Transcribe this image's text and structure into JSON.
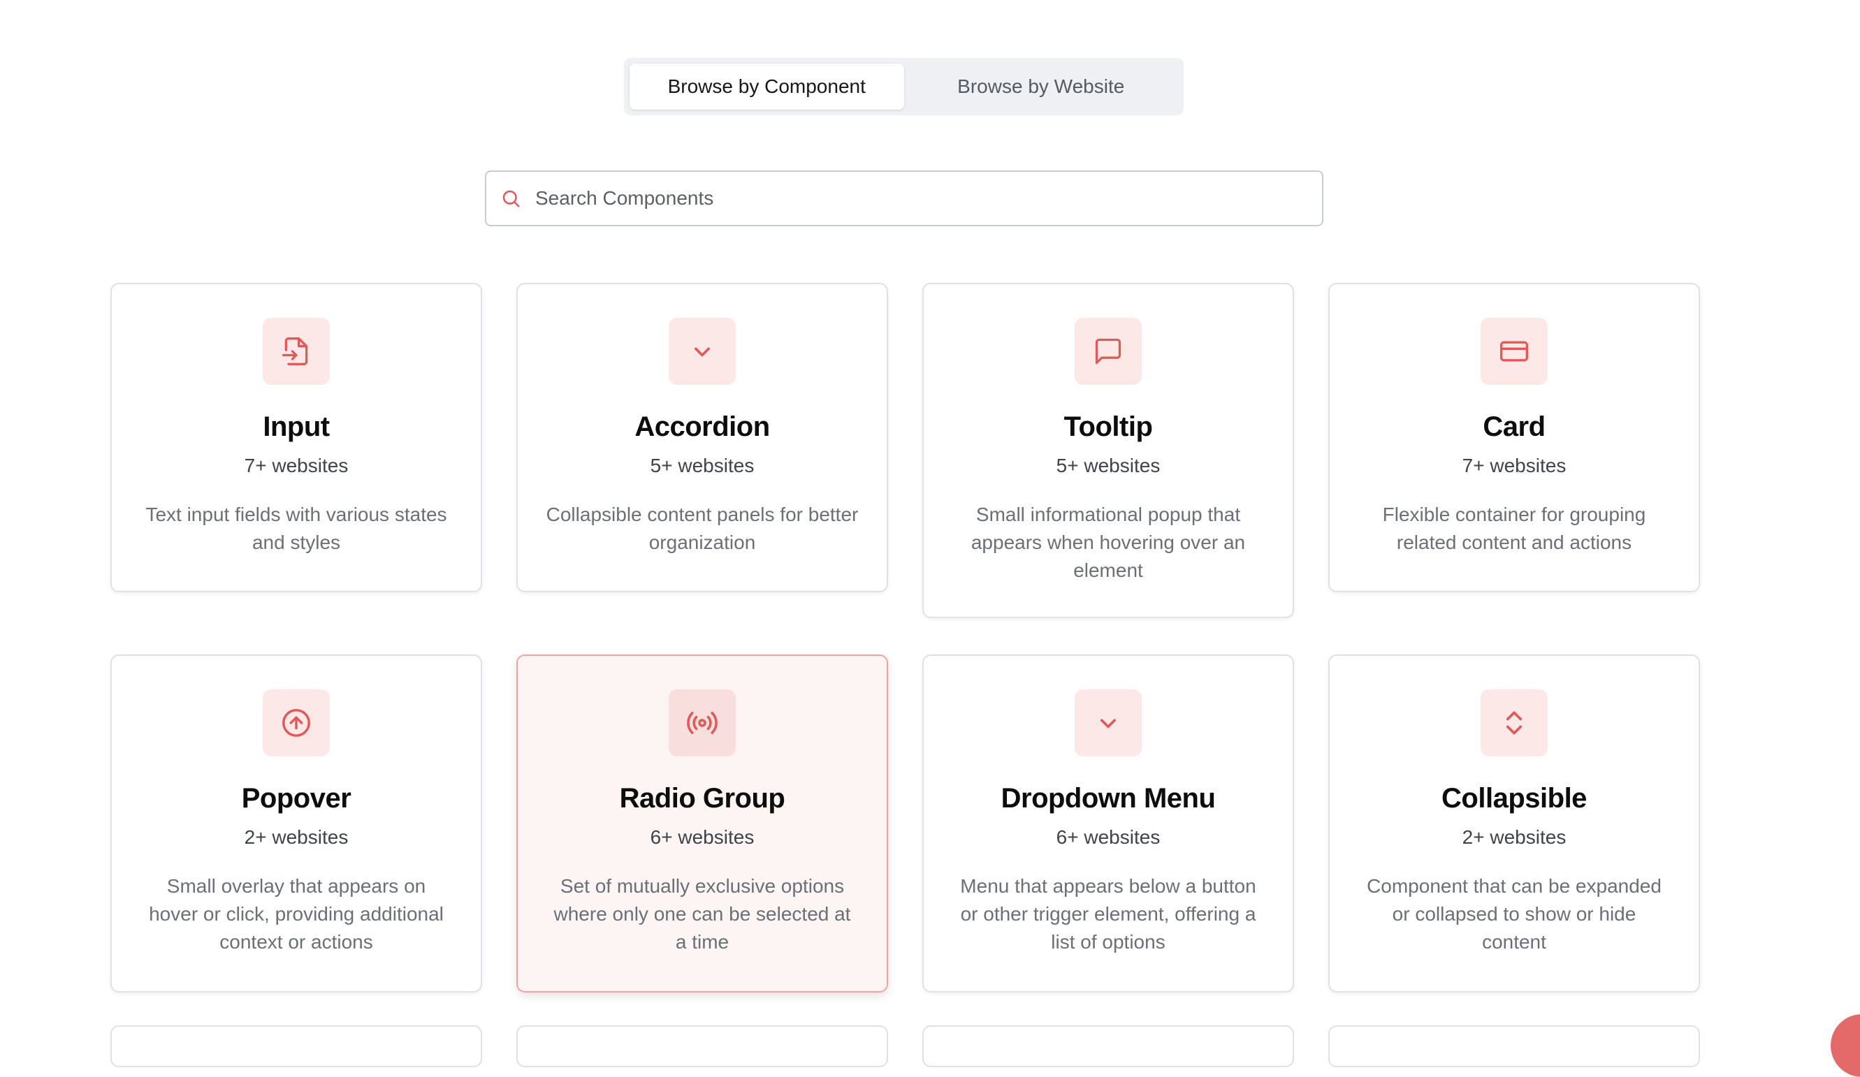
{
  "tabs": [
    {
      "label": "Browse by Component",
      "active": true
    },
    {
      "label": "Browse by Website",
      "active": false
    }
  ],
  "search": {
    "placeholder": "Search Components",
    "value": ""
  },
  "accent_color": "#e05a5a",
  "cards": [
    {
      "icon": "file-input-icon",
      "title": "Input",
      "count": "7+ websites",
      "description": "Text input fields with various states and styles"
    },
    {
      "icon": "chevron-down-icon",
      "title": "Accordion",
      "count": "5+ websites",
      "description": "Collapsible content panels for better organization"
    },
    {
      "icon": "message-square-icon",
      "title": "Tooltip",
      "count": "5+ websites",
      "description": "Small informational popup that appears when hovering over an element"
    },
    {
      "icon": "credit-card-icon",
      "title": "Card",
      "count": "7+ websites",
      "description": "Flexible container for grouping related content and actions"
    },
    {
      "icon": "circle-arrow-up-icon",
      "title": "Popover",
      "count": "2+ websites",
      "description": "Small overlay that appears on hover or click, providing additional context or actions"
    },
    {
      "icon": "radio-icon",
      "title": "Radio Group",
      "count": "6+ websites",
      "description": "Set of mutually exclusive options where only one can be selected at a time",
      "highlighted": true
    },
    {
      "icon": "chevron-down-icon",
      "title": "Dropdown Menu",
      "count": "6+ websites",
      "description": "Menu that appears below a button or other trigger element, offering a list of options"
    },
    {
      "icon": "chevrons-up-down-icon",
      "title": "Collapsible",
      "count": "2+ websites",
      "description": "Component that can be expanded or collapsed to show or hide content"
    }
  ]
}
